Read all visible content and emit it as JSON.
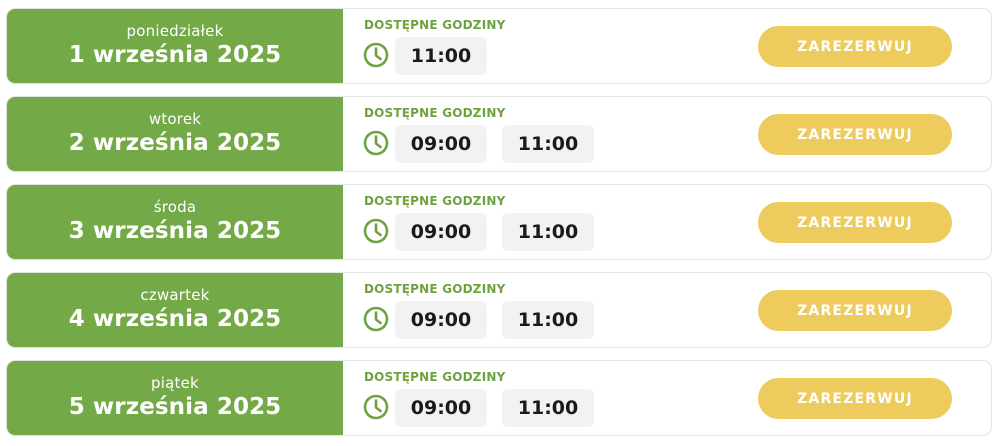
{
  "colors": {
    "date_block": "#73a947",
    "accent_green": "#6ea23e",
    "slot_bg": "#f2f2f2",
    "button_bg": "#eecb5d",
    "button_text": "#ffffff"
  },
  "icons": {
    "clock": "clock-icon"
  },
  "days": [
    {
      "weekday": "poniedziałek",
      "date": "1 września 2025",
      "slots_label": "DOSTĘPNE GODZINY",
      "slots": [
        "11:00"
      ],
      "button_label": "ZAREZERWUJ"
    },
    {
      "weekday": "wtorek",
      "date": "2 września 2025",
      "slots_label": "DOSTĘPNE GODZINY",
      "slots": [
        "09:00",
        "11:00"
      ],
      "button_label": "ZAREZERWUJ"
    },
    {
      "weekday": "środa",
      "date": "3 września 2025",
      "slots_label": "DOSTĘPNE GODZINY",
      "slots": [
        "09:00",
        "11:00"
      ],
      "button_label": "ZAREZERWUJ"
    },
    {
      "weekday": "czwartek",
      "date": "4 września 2025",
      "slots_label": "DOSTĘPNE GODZINY",
      "slots": [
        "09:00",
        "11:00"
      ],
      "button_label": "ZAREZERWUJ"
    },
    {
      "weekday": "piątek",
      "date": "5 września 2025",
      "slots_label": "DOSTĘPNE GODZINY",
      "slots": [
        "09:00",
        "11:00"
      ],
      "button_label": "ZAREZERWUJ"
    }
  ]
}
